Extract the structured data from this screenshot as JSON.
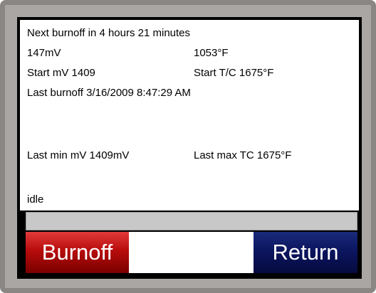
{
  "colors": {
    "bezel": "#a9a6a3",
    "burnoff_button": "#b80c0c",
    "return_button": "#0c1660",
    "status_bar": "#c8c8c8"
  },
  "info": {
    "next_burnoff": "Next burnoff in 4 hours 21 minutes",
    "mv_reading": "147mV",
    "temp_reading": "1053°F",
    "start_mv": "Start mV 1409",
    "start_tc": "Start T/C 1675°F",
    "last_burnoff": "Last burnoff 3/16/2009 8:47:29 AM",
    "last_min_mv": "Last min mV 1409mV",
    "last_max_tc": "Last max TC 1675°F",
    "state": "idle"
  },
  "buttons": {
    "burnoff": "Burnoff",
    "return": "Return"
  }
}
